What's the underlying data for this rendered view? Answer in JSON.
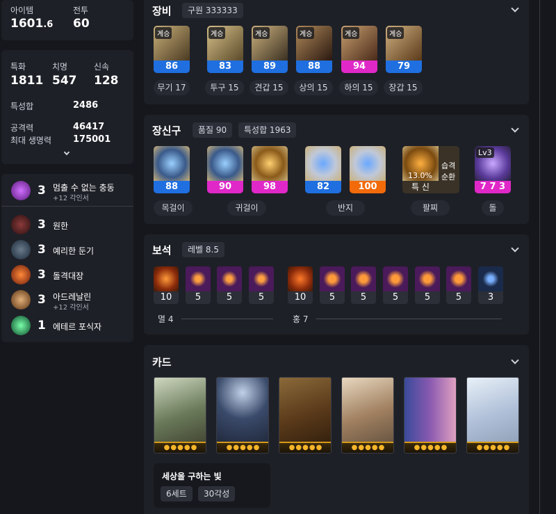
{
  "summary": {
    "item_level_label": "아이템",
    "item_level_int": "1601",
    "item_level_dec": ".6",
    "combat_label": "전투",
    "combat_value": "60"
  },
  "stats": {
    "crit_spec_label": "특화",
    "crit_spec_value": "1811",
    "crit_label": "치명",
    "crit_value": "547",
    "swift_label": "신속",
    "swift_value": "128",
    "total_label": "특성합",
    "total_value": "2486",
    "atk_label": "공격력",
    "atk_value": "46417",
    "hp_label": "최대 생명력",
    "hp_value": "175001"
  },
  "engravings": [
    {
      "level": "3",
      "name": "멈출 수 없는 충동",
      "sub": "+12 각인서",
      "color": "#8a3fb0"
    },
    {
      "level": "3",
      "name": "원한",
      "sub": "",
      "color": "#6b2a2a"
    },
    {
      "level": "3",
      "name": "예리한 둔기",
      "sub": "",
      "color": "#3a4a5a"
    },
    {
      "level": "3",
      "name": "돌격대장",
      "sub": "",
      "color": "#a03a1a"
    },
    {
      "level": "3",
      "name": "아드레날린",
      "sub": "+12 각인서",
      "color": "#b07a3a"
    },
    {
      "level": "1",
      "name": "에테르 포식자",
      "sub": "",
      "color": "#2a8a5a"
    }
  ],
  "equipment": {
    "title": "장비",
    "chip": "구원 333333",
    "tag": "계승",
    "items": [
      {
        "quality": "86",
        "bar_color": "#1f6fe0",
        "label": "무기 17"
      },
      {
        "quality": "83",
        "bar_color": "#1f6fe0",
        "label": "투구 15"
      },
      {
        "quality": "89",
        "bar_color": "#1f6fe0",
        "label": "견갑 15"
      },
      {
        "quality": "88",
        "bar_color": "#1f6fe0",
        "label": "상의 15"
      },
      {
        "quality": "94",
        "bar_color": "#e028c8",
        "label": "하의 15"
      },
      {
        "quality": "79",
        "bar_color": "#1f6fe0",
        "label": "장갑 15"
      }
    ]
  },
  "accessories": {
    "title": "장신구",
    "chip1": "품질 90",
    "chip2": "특성합 1963",
    "items": [
      {
        "quality": "88",
        "bar_color": "#1f6fe0"
      },
      {
        "quality": "90",
        "bar_color": "#e028c8"
      },
      {
        "quality": "98",
        "bar_color": "#e028c8"
      },
      {
        "quality": "82",
        "bar_color": "#1f6fe0"
      },
      {
        "quality": "100",
        "bar_color": "#f26a0a"
      }
    ],
    "bracelet_pct": "13.0%",
    "bracelet_bar": "특 신",
    "bracelet_text1": "습격",
    "bracelet_text2": "순환",
    "stone_lv": "Lv3",
    "stone_bar": "7 7 3",
    "labels": [
      "목걸이",
      "귀걸이",
      "반지",
      "팔찌",
      "돌"
    ]
  },
  "gems": {
    "title": "보석",
    "chip": "레벨 8.5",
    "left_values": [
      "10",
      "5",
      "5",
      "5"
    ],
    "right_values": [
      "10",
      "5",
      "5",
      "5",
      "5",
      "5",
      "3"
    ],
    "left_label": "멸 4",
    "right_label": "홍 7"
  },
  "cards": {
    "title": "카드",
    "stars": "●●●●●",
    "set_name": "세상을 구하는 빛",
    "set_chip1": "6세트",
    "set_chip2": "30각성"
  }
}
